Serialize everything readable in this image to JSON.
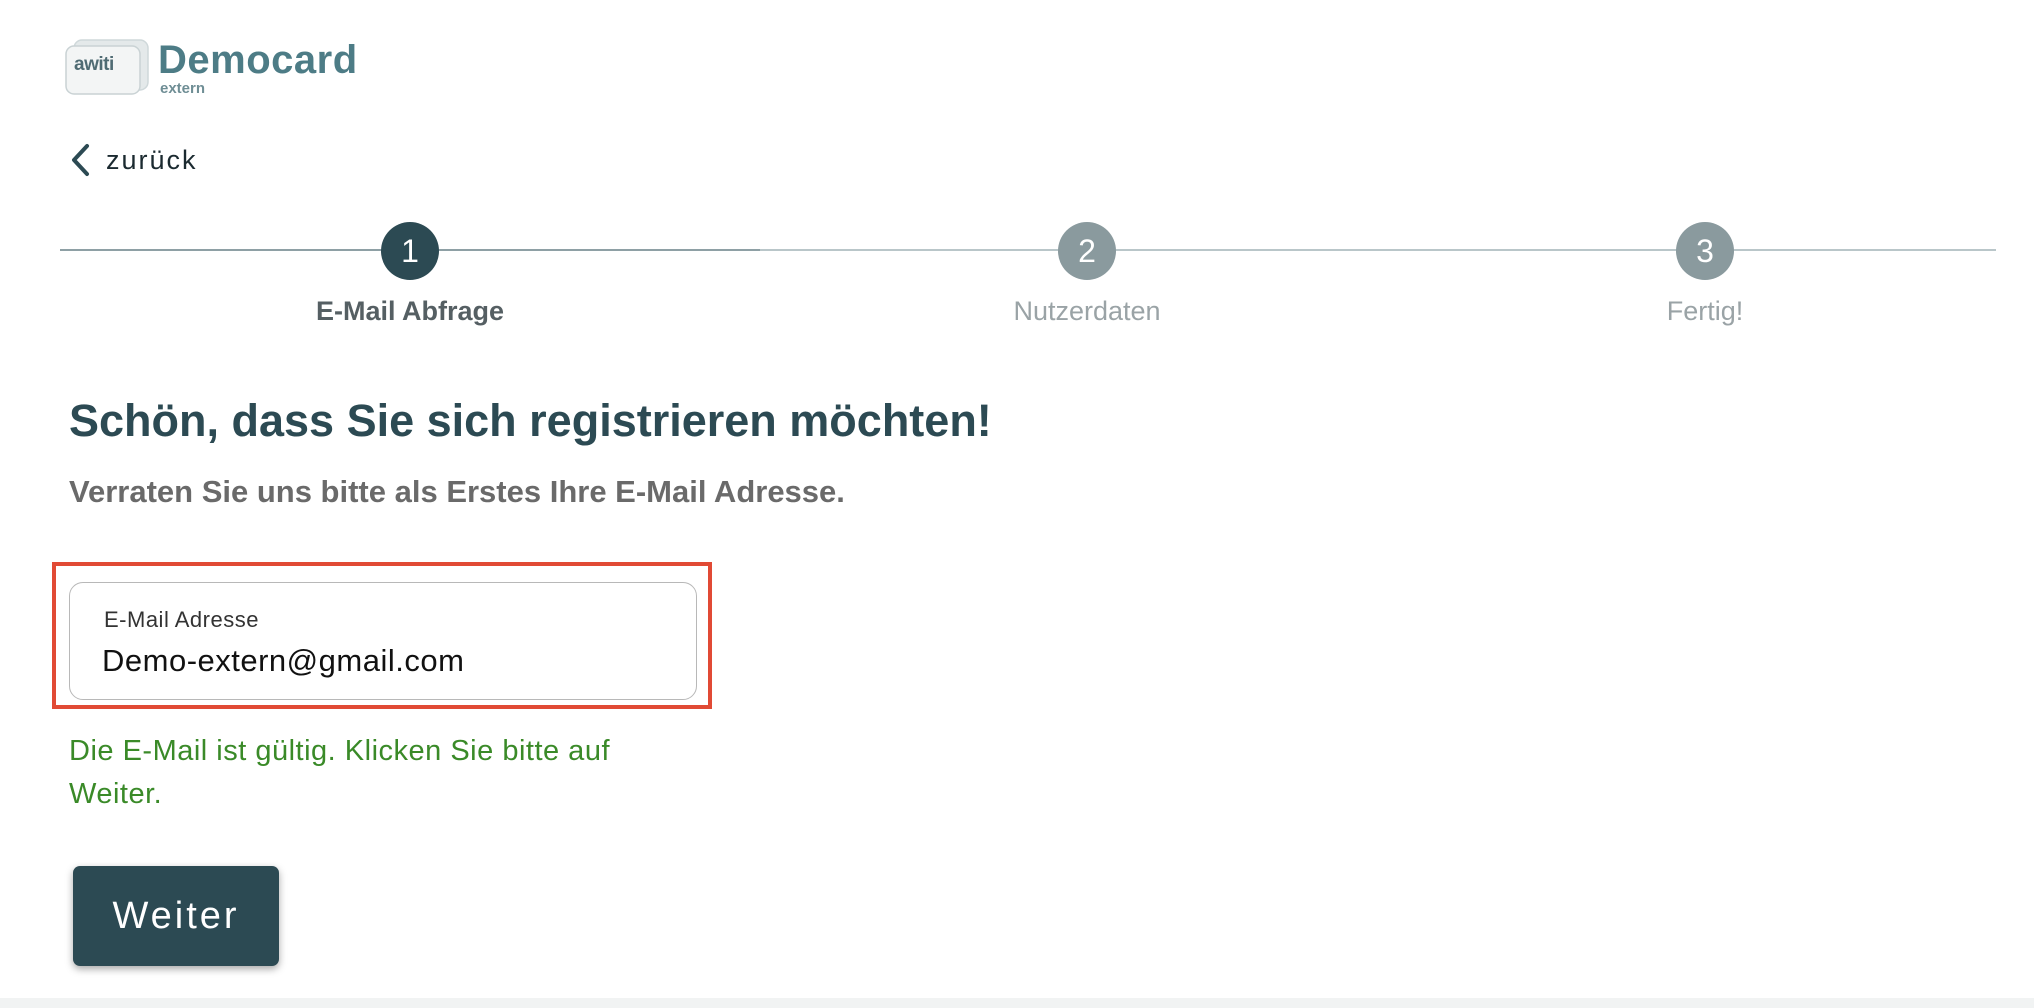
{
  "brand": {
    "mark_text": "awiti",
    "name": "Democard",
    "subtitle": "extern"
  },
  "nav": {
    "back_label": "zurück"
  },
  "steps": [
    {
      "number": "1",
      "label": "E-Mail Abfrage",
      "state": "active"
    },
    {
      "number": "2",
      "label": "Nutzerdaten",
      "state": "inactive"
    },
    {
      "number": "3",
      "label": "Fertig!",
      "state": "inactive"
    }
  ],
  "form": {
    "heading": "Schön, dass Sie sich registrieren möchten!",
    "subheading": "Verraten Sie uns bitte als Erstes Ihre E-Mail Adresse.",
    "email_label": "E-Mail Adresse",
    "email_value": "Demo-extern@gmail.com",
    "validation_message": "Die E-Mail ist gültig. Klicken Sie bitte auf Weiter.",
    "submit_label": "Weiter"
  },
  "colors": {
    "primary": "#2c4a53",
    "success": "#3a8a28",
    "highlight": "#e14a35",
    "step_inactive": "#8a9a9e"
  }
}
